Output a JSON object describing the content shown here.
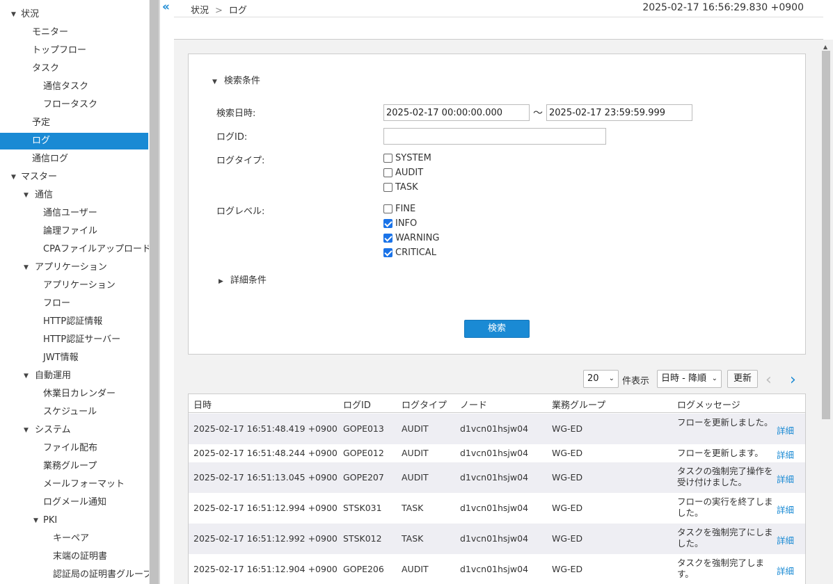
{
  "sidebar": {
    "items": [
      {
        "label": "状況",
        "level": 0,
        "expandable": true
      },
      {
        "label": "モニター",
        "level": 2
      },
      {
        "label": "トップフロー",
        "level": 2
      },
      {
        "label": "タスク",
        "level": 2
      },
      {
        "label": "通信タスク",
        "level": 3
      },
      {
        "label": "フロータスク",
        "level": 3
      },
      {
        "label": "予定",
        "level": 2
      },
      {
        "label": "ログ",
        "level": 2,
        "active": true
      },
      {
        "label": "通信ログ",
        "level": 2
      },
      {
        "label": "マスター",
        "level": 0,
        "expandable": true
      },
      {
        "label": "通信",
        "level": 1,
        "expandable": true
      },
      {
        "label": "通信ユーザー",
        "level": 3
      },
      {
        "label": "論理ファイル",
        "level": 3
      },
      {
        "label": "CPAファイルアップロード",
        "level": 3
      },
      {
        "label": "アプリケーション",
        "level": 1,
        "expandable": true
      },
      {
        "label": "アプリケーション",
        "level": 3
      },
      {
        "label": "フロー",
        "level": 3
      },
      {
        "label": "HTTP認証情報",
        "level": 3
      },
      {
        "label": "HTTP認証サーバー",
        "level": 3
      },
      {
        "label": "JWT情報",
        "level": 3
      },
      {
        "label": "自動運用",
        "level": 1,
        "expandable": true
      },
      {
        "label": "休業日カレンダー",
        "level": 3
      },
      {
        "label": "スケジュール",
        "level": 3
      },
      {
        "label": "システム",
        "level": 1,
        "expandable": true
      },
      {
        "label": "ファイル配布",
        "level": 3
      },
      {
        "label": "業務グループ",
        "level": 3
      },
      {
        "label": "メールフォーマット",
        "level": 3
      },
      {
        "label": "ログメール通知",
        "level": 3
      },
      {
        "label": "PKI",
        "level": 2,
        "expandable": true
      },
      {
        "label": "キーペア",
        "level": 4
      },
      {
        "label": "末端の証明書",
        "level": 4
      },
      {
        "label": "認証局の証明書グループ",
        "level": 4
      }
    ]
  },
  "header": {
    "collapse_glyph": "«",
    "breadcrumb": [
      "状況",
      "ログ"
    ],
    "breadcrumb_sep": ">",
    "timestamp": "2025-02-17 16:56:29.830 +0900"
  },
  "search": {
    "section_title": "検索条件",
    "date_label": "検索日時:",
    "date_from": "2025-02-17 00:00:00.000",
    "date_sep": "～",
    "date_to": "2025-02-17 23:59:59.999",
    "logid_label": "ログID:",
    "logid_value": "",
    "logtype_label": "ログタイプ:",
    "logtypes": [
      {
        "label": "SYSTEM",
        "checked": false
      },
      {
        "label": "AUDIT",
        "checked": false
      },
      {
        "label": "TASK",
        "checked": false
      }
    ],
    "loglevel_label": "ログレベル:",
    "loglevels": [
      {
        "label": "FINE",
        "checked": false
      },
      {
        "label": "INFO",
        "checked": true
      },
      {
        "label": "WARNING",
        "checked": true
      },
      {
        "label": "CRITICAL",
        "checked": true
      }
    ],
    "detail_title": "詳細条件",
    "search_button": "検索"
  },
  "controls": {
    "page_size": "20",
    "page_size_suffix": "件表示",
    "sort": "日時 - 降順",
    "refresh_button": "更新",
    "prev_glyph": "‹",
    "next_glyph": "›"
  },
  "table": {
    "columns": [
      "日時",
      "ログID",
      "ログタイプ",
      "ノード",
      "業務グループ",
      "ログメッセージ"
    ],
    "link_label": "詳細",
    "rows": [
      {
        "datetime": "2025-02-17 16:51:48.419 +0900",
        "logid": "GOPE013",
        "type": "AUDIT",
        "node": "d1vcn01hsjw04",
        "group": "WG-ED",
        "message": "フローを更新しました。"
      },
      {
        "datetime": "2025-02-17 16:51:48.244 +0900",
        "logid": "GOPE012",
        "type": "AUDIT",
        "node": "d1vcn01hsjw04",
        "group": "WG-ED",
        "message": "フローを更新します。"
      },
      {
        "datetime": "2025-02-17 16:51:13.045 +0900",
        "logid": "GOPE207",
        "type": "AUDIT",
        "node": "d1vcn01hsjw04",
        "group": "WG-ED",
        "message": "タスクの強制完了操作を受け付けました。"
      },
      {
        "datetime": "2025-02-17 16:51:12.994 +0900",
        "logid": "STSK031",
        "type": "TASK",
        "node": "d1vcn01hsjw04",
        "group": "WG-ED",
        "message": "フローの実行を終了しました。"
      },
      {
        "datetime": "2025-02-17 16:51:12.992 +0900",
        "logid": "STSK012",
        "type": "TASK",
        "node": "d1vcn01hsjw04",
        "group": "WG-ED",
        "message": "タスクを強制完了にしました。"
      },
      {
        "datetime": "2025-02-17 16:51:12.904 +0900",
        "logid": "GOPE206",
        "type": "AUDIT",
        "node": "d1vcn01hsjw04",
        "group": "WG-ED",
        "message": "タスクを強制完了します。"
      }
    ]
  }
}
